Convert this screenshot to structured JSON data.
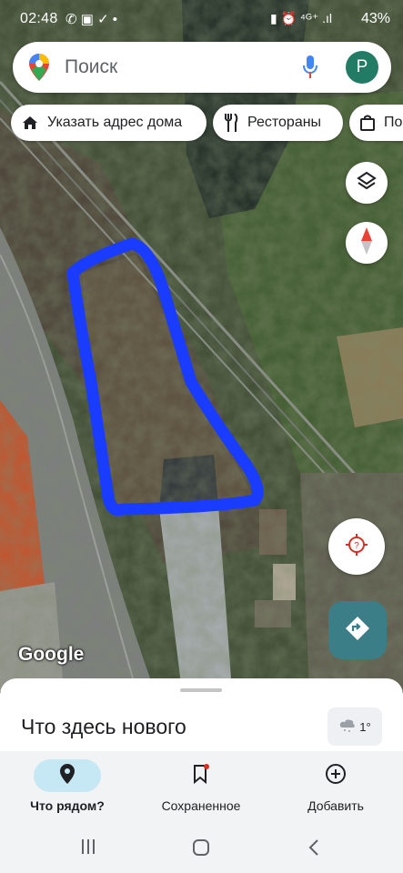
{
  "status_bar": {
    "time": "02:48",
    "left_icons": "✆ ▣ ✓ •",
    "right_icons": "▮ ⏰ ⁴ᴳ⁺ .ıl",
    "battery": "43%"
  },
  "search": {
    "placeholder": "Поиск",
    "avatar_letter": "P"
  },
  "chips": [
    {
      "label": "Указать адрес дома",
      "icon": "home-icon"
    },
    {
      "label": "Рестораны",
      "icon": "restaurant-icon"
    },
    {
      "label": "По",
      "icon": "shopping-bag-icon"
    }
  ],
  "map": {
    "google_logo": "Google",
    "highlight_color": "#1a3cff"
  },
  "sheet": {
    "title": "Что здесь нового",
    "weather": "1°"
  },
  "nav": {
    "items": [
      {
        "label": "Что рядом?",
        "icon": "pin-icon",
        "active": true
      },
      {
        "label": "Сохраненное",
        "icon": "bookmark-icon"
      },
      {
        "label": "Добавить",
        "icon": "add-circle-icon"
      }
    ]
  },
  "colors": {
    "accent": "#3b7e87",
    "avatar": "#227b64",
    "active_nav": "#c6e7f4"
  }
}
